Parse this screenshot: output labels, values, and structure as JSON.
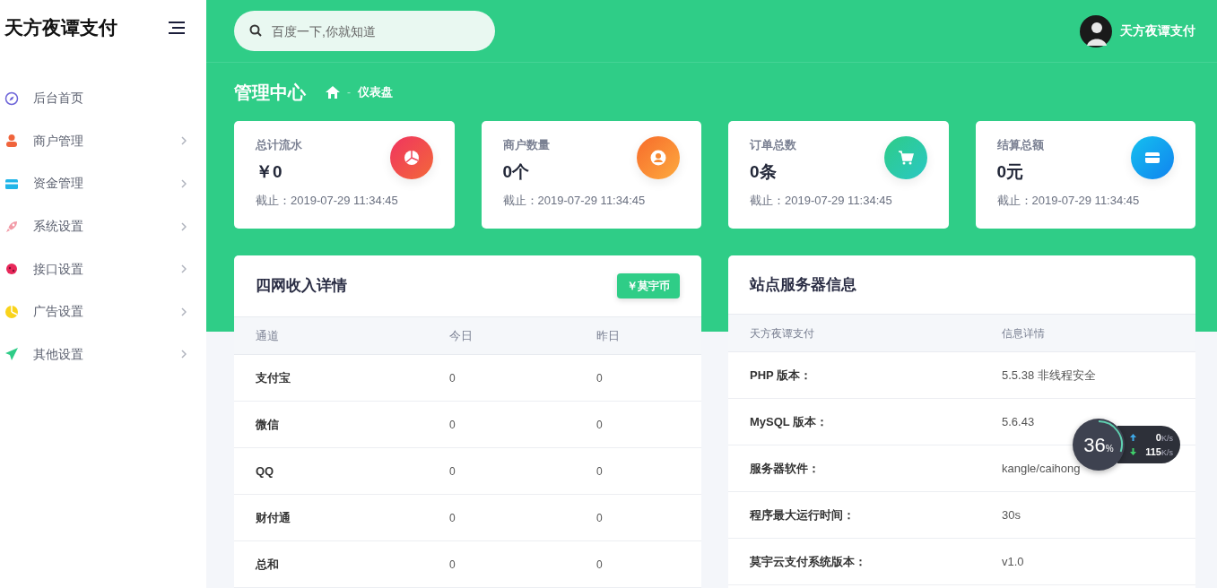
{
  "brand": "天方夜谭支付",
  "sidebar": {
    "items": [
      {
        "label": "后台首页",
        "kind": "compass",
        "expandable": false
      },
      {
        "label": "商户管理",
        "kind": "user",
        "expandable": true
      },
      {
        "label": "资金管理",
        "kind": "card",
        "expandable": true
      },
      {
        "label": "系统设置",
        "kind": "rocket",
        "expandable": true
      },
      {
        "label": "接口设置",
        "kind": "bug",
        "expandable": true
      },
      {
        "label": "广告设置",
        "kind": "pie",
        "expandable": true
      },
      {
        "label": "其他设置",
        "kind": "send",
        "expandable": true
      }
    ]
  },
  "search": {
    "placeholder": "百度一下,你就知道"
  },
  "user": {
    "name": "天方夜谭支付"
  },
  "page_title": "管理中心",
  "breadcrumb": {
    "separator": "-",
    "current": "仪表盘"
  },
  "stats": [
    {
      "label": "总计流水",
      "value": "￥0",
      "kind": "pie",
      "note": "截止：2019-07-29 11:34:45"
    },
    {
      "label": "商户数量",
      "value": "0个",
      "kind": "user",
      "note": "截止：2019-07-29 11:34:45"
    },
    {
      "label": "订单总数",
      "value": "0条",
      "kind": "cart",
      "note": "截止：2019-07-29 11:34:45"
    },
    {
      "label": "结算总额",
      "value": "0元",
      "kind": "card",
      "note": "截止：2019-07-29 11:34:45"
    }
  ],
  "income": {
    "title": "四网收入详情",
    "button": "￥莫宇币",
    "columns": [
      "通道",
      "今日",
      "昨日"
    ],
    "rows": [
      [
        "支付宝",
        "0",
        "0"
      ],
      [
        "微信",
        "0",
        "0"
      ],
      [
        "QQ",
        "0",
        "0"
      ],
      [
        "财付通",
        "0",
        "0"
      ],
      [
        "总和",
        "0",
        "0"
      ]
    ]
  },
  "server": {
    "title": "站点服务器信息",
    "columns": [
      "天方夜谭支付",
      "信息详情"
    ],
    "rows": [
      [
        "PHP 版本：",
        "5.5.38 非线程安全"
      ],
      [
        "MySQL 版本：",
        "5.6.43"
      ],
      [
        "服务器软件：",
        "kangle/caihong"
      ],
      [
        "程序最大运行时间：",
        "30s"
      ],
      [
        "莫宇云支付系统版本：",
        "v1.0"
      ]
    ]
  },
  "net_monitor": {
    "percent": "36",
    "percent_sign": "%",
    "upload": "0",
    "upload_unit": "K/s",
    "download": "115",
    "download_unit": "K/s"
  }
}
